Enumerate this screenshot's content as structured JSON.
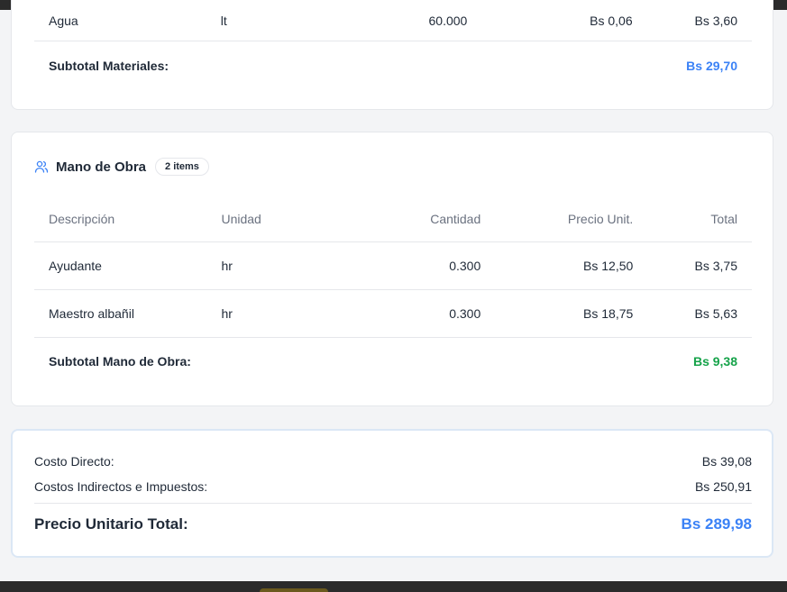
{
  "materials": {
    "rows": [
      {
        "description": "Agua",
        "unit": "lt",
        "quantity": "60.000",
        "unit_price": "Bs 0,06",
        "total": "Bs 3,60"
      }
    ],
    "subtotal_label": "Subtotal Materiales:",
    "subtotal_value": "Bs 29,70"
  },
  "labor": {
    "title": "Mano de Obra",
    "badge": "2 items",
    "icon": "users-icon",
    "columns": {
      "description": "Descripción",
      "unit": "Unidad",
      "quantity": "Cantidad",
      "unit_price": "Precio Unit.",
      "total": "Total"
    },
    "rows": [
      {
        "description": "Ayudante",
        "unit": "hr",
        "quantity": "0.300",
        "unit_price": "Bs 12,50",
        "total": "Bs 3,75"
      },
      {
        "description": "Maestro albañil",
        "unit": "hr",
        "quantity": "0.300",
        "unit_price": "Bs 18,75",
        "total": "Bs 5,63"
      }
    ],
    "subtotal_label": "Subtotal Mano de Obra:",
    "subtotal_value": "Bs 9,38"
  },
  "summary": {
    "direct_label": "Costo Directo:",
    "direct_value": "Bs 39,08",
    "indirect_label": "Costos Indirectos e Impuestos:",
    "indirect_value": "Bs 250,91",
    "total_label": "Precio Unitario Total:",
    "total_value": "Bs 289,98"
  },
  "colors": {
    "accent_blue": "#3b82f6",
    "accent_green": "#16a34a"
  }
}
